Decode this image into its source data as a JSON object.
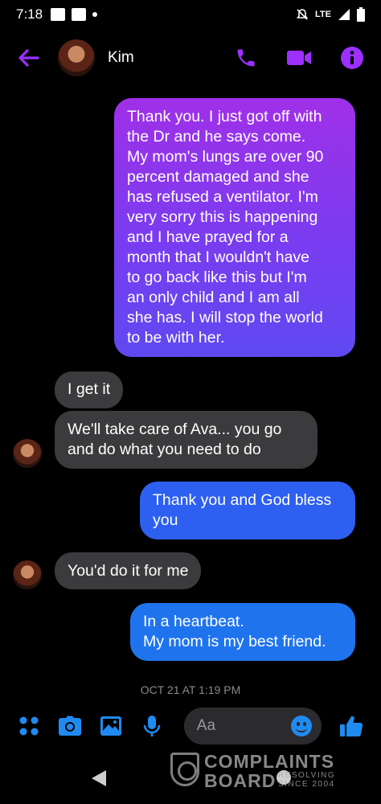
{
  "status_bar": {
    "time": "7:18",
    "network": "LTE"
  },
  "header": {
    "contact_name": "Kim",
    "accent_color": "#9b30ff"
  },
  "messages": [
    {
      "from": "me",
      "lines": [
        "Thank you. I just got off with",
        "the Dr and he says come.",
        "My mom's lungs are over 90",
        "percent damaged and she",
        "has refused a ventilator. I'm",
        "very sorry this is happening",
        "and I have prayed for a",
        "month that I wouldn't have",
        "to go back like this but I'm",
        "an only child and I am all",
        "she has. I will stop the world",
        "to be with her."
      ]
    },
    {
      "from": "Kim",
      "lines": [
        "I get it"
      ]
    },
    {
      "from": "Kim",
      "lines": [
        "We'll take care of Ava... you go",
        "and do what you need to do"
      ]
    },
    {
      "from": "me",
      "lines": [
        "Thank you and God bless",
        "you"
      ]
    },
    {
      "from": "Kim",
      "lines": [
        "You'd do it for me"
      ]
    },
    {
      "from": "me",
      "lines": [
        "In a heartbeat.",
        "My mom is my best friend."
      ]
    }
  ],
  "timestamp": "OCT 21 AT 1:19 PM",
  "composer": {
    "placeholder": "Aa"
  },
  "watermark": {
    "line1": "COMPLAINTS",
    "line2": "BOARD",
    "sub1": "RESOLVING",
    "sub2": "SINCE 2004"
  },
  "colors": {
    "icon_blue": "#1f8bf0",
    "header_purple": "#9b30ff",
    "received_bubble": "#3b3b3d"
  }
}
